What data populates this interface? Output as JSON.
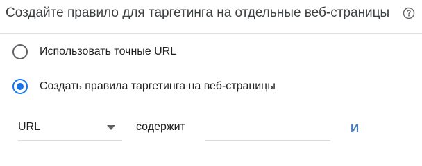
{
  "section": {
    "title": "Создайте правило для таргетинга на отдельные веб-страницы",
    "help_icon": "help-circle-icon"
  },
  "options": [
    {
      "label": "Использовать точные URL",
      "selected": false
    },
    {
      "label": "Создать правила таргетинга на веб-страницы",
      "selected": true
    }
  ],
  "rule": {
    "field": "URL",
    "operator": "содержит",
    "value": "",
    "and_label": "И"
  },
  "colors": {
    "accent": "#1a73e8",
    "and_link": "#4a7fc1",
    "divider": "#e0e0e0"
  }
}
